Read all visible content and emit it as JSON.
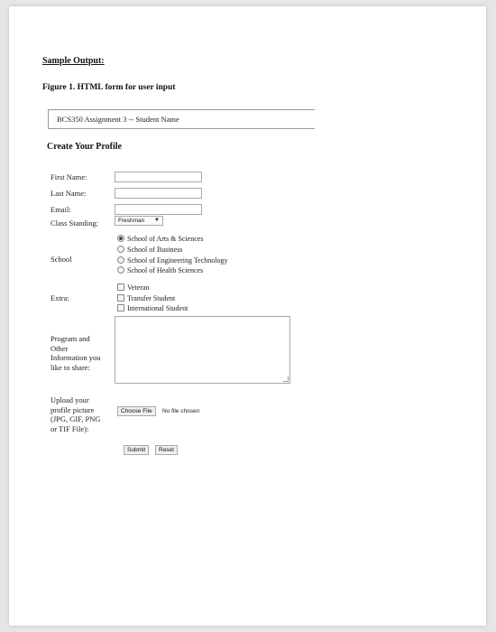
{
  "sample_heading": "Sample Output:",
  "figure_caption": "Figure 1. HTML form for user input",
  "assignment_title": "BCS350 Assignment 3 -- Student Name",
  "form_title": "Create Your Profile",
  "fields": {
    "first_name_label": "First Name:",
    "first_name_value": "",
    "last_name_label": "Last Name:",
    "last_name_value": "",
    "email_label": "Email:",
    "email_value": "",
    "class_standing_label": "Class Standing:",
    "class_standing_selected": "Freshman",
    "school_label": "School",
    "school_options": [
      "School of Arts & Sciences",
      "School of Business",
      "School of Engineering Technology",
      "School of Health Sciences"
    ],
    "school_selected_index": 0,
    "extra_label": "Extra:",
    "extra_options": [
      "Veteran",
      "Transfer Student",
      "International Student"
    ],
    "program_label": [
      "Program and",
      "Other",
      "Information you",
      "like to share:"
    ],
    "upload_label": [
      "Upload your",
      "profile picture",
      "(JPG, GIF, PNG",
      "or TIF File):"
    ],
    "choose_file_label": "Choose File",
    "no_file_text": "No file chosen",
    "submit_label": "Submit",
    "reset_label": "Reset"
  },
  "icons": {
    "select_arrow": "chevron-down-icon"
  }
}
